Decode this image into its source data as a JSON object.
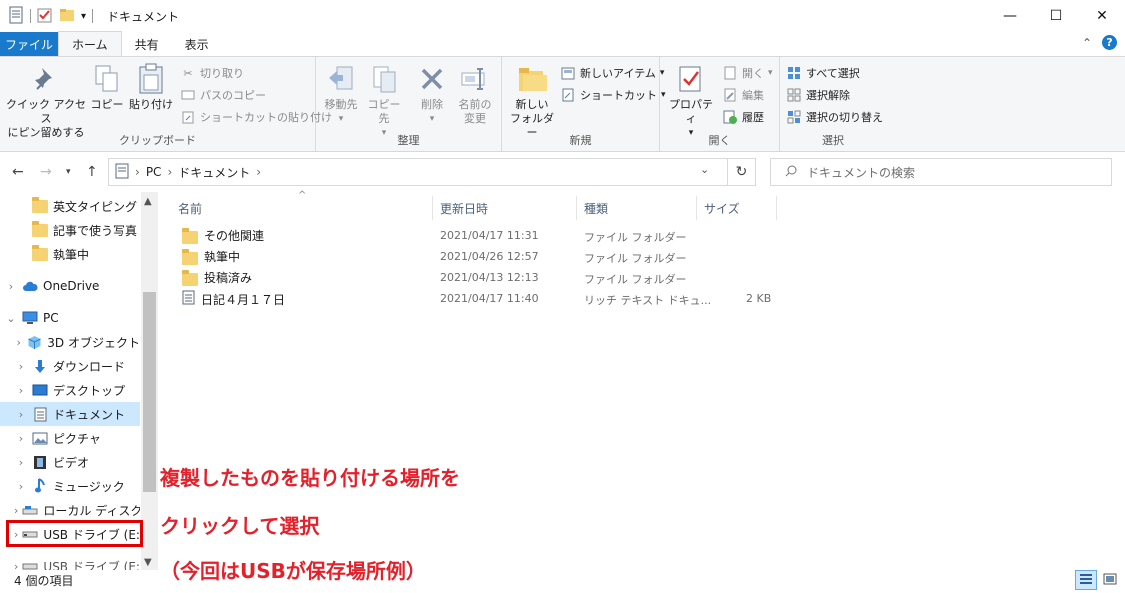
{
  "window": {
    "title": "ドキュメント",
    "minimize": "—",
    "maximize": "☐",
    "close": "✕"
  },
  "tabs": [
    {
      "label": "ファイル"
    },
    {
      "label": "ホーム"
    },
    {
      "label": "共有"
    },
    {
      "label": "表示"
    }
  ],
  "ribbon": {
    "clipboard": {
      "pin_label_1": "クイック アクセス",
      "pin_label_2": "にピン留めする",
      "copy": "コピー",
      "paste": "貼り付け",
      "cut": "切り取り",
      "copy_path": "パスのコピー",
      "paste_shortcut": "ショートカットの貼り付け",
      "group": "クリップボード"
    },
    "organize": {
      "move_to": "移動先",
      "copy_to": "コピー先",
      "delete": "削除",
      "rename_1": "名前の",
      "rename_2": "変更",
      "group": "整理"
    },
    "new": {
      "new_folder_1": "新しい",
      "new_folder_2": "フォルダー",
      "new_item": "新しいアイテム",
      "shortcut": "ショートカット",
      "group": "新規"
    },
    "open": {
      "properties": "プロパティ",
      "open": "開く",
      "edit": "編集",
      "history": "履歴",
      "group": "開く"
    },
    "select": {
      "select_all": "すべて選択",
      "select_none": "選択解除",
      "invert": "選択の切り替え",
      "group": "選択"
    }
  },
  "address": {
    "path": [
      "PC",
      "ドキュメント"
    ],
    "search_placeholder": "ドキュメントの検索"
  },
  "nav_pane": {
    "items": [
      {
        "label": "英文タイピング",
        "icon": "folder"
      },
      {
        "label": "記事で使う写真",
        "icon": "folder"
      },
      {
        "label": "執筆中",
        "icon": "folder"
      },
      {
        "label": "OneDrive",
        "icon": "cloud"
      },
      {
        "label": "PC",
        "icon": "pc"
      },
      {
        "label": "3D オブジェクト",
        "icon": "3d"
      },
      {
        "label": "ダウンロード",
        "icon": "download"
      },
      {
        "label": "デスクトップ",
        "icon": "desktop"
      },
      {
        "label": "ドキュメント",
        "icon": "document"
      },
      {
        "label": "ピクチャ",
        "icon": "pictures"
      },
      {
        "label": "ビデオ",
        "icon": "video"
      },
      {
        "label": "ミュージック",
        "icon": "music"
      },
      {
        "label": "ローカル ディスク (C",
        "icon": "disk"
      },
      {
        "label": "USB ドライブ (E:)",
        "icon": "usb"
      },
      {
        "label": "USB ドライブ (E:)",
        "icon": "usb"
      }
    ]
  },
  "file_list": {
    "columns": [
      "名前",
      "更新日時",
      "種類",
      "サイズ"
    ],
    "rows": [
      {
        "name": "その他関連",
        "date": "2021/04/17 11:31",
        "type": "ファイル フォルダー",
        "size": "",
        "icon": "folder"
      },
      {
        "name": "執筆中",
        "date": "2021/04/26 12:57",
        "type": "ファイル フォルダー",
        "size": "",
        "icon": "folder"
      },
      {
        "name": "投稿済み",
        "date": "2021/04/13 12:13",
        "type": "ファイル フォルダー",
        "size": "",
        "icon": "folder"
      },
      {
        "name": "日記４月１７日",
        "date": "2021/04/17 11:40",
        "type": "リッチ テキスト ドキュ...",
        "size": "2 KB",
        "icon": "rtf"
      }
    ]
  },
  "annotation": {
    "line1": "複製したものを貼り付ける場所を",
    "line2": "クリックして選択",
    "line3": "（今回はUSBが保存場所例）",
    "color": "#e4202a"
  },
  "status": {
    "count": "4 個の項目"
  },
  "colors": {
    "accent": "#1979ca",
    "selection": "#cce8ff",
    "highlight_box": "#e00000"
  }
}
